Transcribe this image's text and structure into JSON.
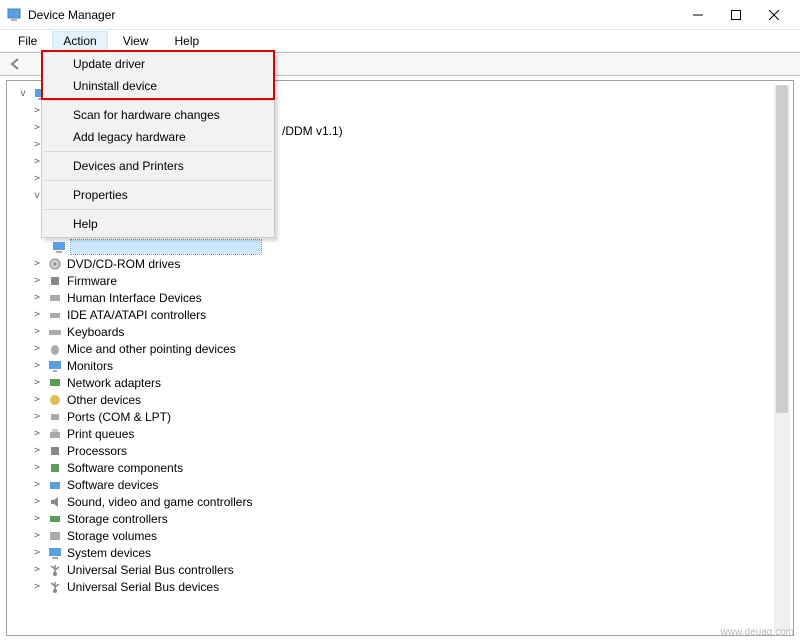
{
  "title": "Device Manager",
  "menus": {
    "file": "File",
    "action": "Action",
    "view": "View",
    "help": "Help"
  },
  "dropdown": {
    "update": "Update driver",
    "uninstall": "Uninstall device",
    "scan": "Scan for hardware changes",
    "legacy": "Add legacy hardware",
    "devprint": "Devices and Printers",
    "props": "Properties",
    "help": "Help"
  },
  "visible_fragment": "/DDM v1.1)",
  "tree": {
    "n4": "DVD/CD-ROM drives",
    "n5": "Firmware",
    "n6": "Human Interface Devices",
    "n7": "IDE ATA/ATAPI controllers",
    "n8": "Keyboards",
    "n9": "Mice and other pointing devices",
    "n10": "Monitors",
    "n11": "Network adapters",
    "n12": "Other devices",
    "n13": "Ports (COM & LPT)",
    "n14": "Print queues",
    "n15": "Processors",
    "n16": "Software components",
    "n17": "Software devices",
    "n18": "Sound, video and game controllers",
    "n19": "Storage controllers",
    "n20": "Storage volumes",
    "n21": "System devices",
    "n22": "Universal Serial Bus controllers",
    "n23": "Universal Serial Bus devices"
  },
  "watermark": "www.deuaq.com"
}
